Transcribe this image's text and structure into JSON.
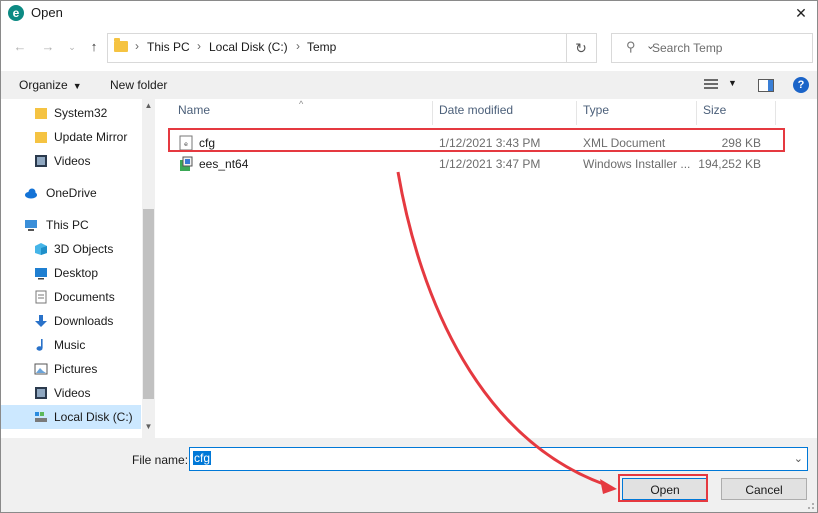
{
  "window": {
    "title": "Open",
    "app_icon": "eset-e-icon",
    "close_glyph": "✕"
  },
  "address": {
    "breadcrumb": [
      "This PC",
      "Local Disk (C:)",
      "Temp"
    ],
    "separator": "›"
  },
  "search": {
    "placeholder": "Search Temp"
  },
  "toolbar": {
    "organize_label": "Organize",
    "new_folder_label": "New folder",
    "help_glyph": "?"
  },
  "sidebar": {
    "items": [
      {
        "label": "System32",
        "icon": "folder-icon"
      },
      {
        "label": "Update Mirror",
        "icon": "folder-icon"
      },
      {
        "label": "Videos",
        "icon": "video-folder-icon"
      },
      {
        "label": "OneDrive",
        "icon": "cloud-icon"
      },
      {
        "label": "This PC",
        "icon": "computer-icon"
      },
      {
        "label": "3D Objects",
        "icon": "cube-icon"
      },
      {
        "label": "Desktop",
        "icon": "desktop-icon"
      },
      {
        "label": "Documents",
        "icon": "document-icon"
      },
      {
        "label": "Downloads",
        "icon": "download-icon"
      },
      {
        "label": "Music",
        "icon": "music-icon"
      },
      {
        "label": "Pictures",
        "icon": "pictures-icon"
      },
      {
        "label": "Videos",
        "icon": "video-folder-icon"
      },
      {
        "label": "Local Disk (C:)",
        "icon": "drive-icon",
        "selected": true
      }
    ]
  },
  "files": {
    "columns": [
      "Name",
      "Date modified",
      "Type",
      "Size"
    ],
    "rows": [
      {
        "name": "cfg",
        "date": "1/12/2021 3:43 PM",
        "type": "XML Document",
        "size": "298 KB",
        "icon": "xml-file-icon"
      },
      {
        "name": "ees_nt64",
        "date": "1/12/2021 3:47 PM",
        "type": "Windows Installer ...",
        "size": "194,252 KB",
        "icon": "installer-icon"
      }
    ]
  },
  "footer": {
    "file_name_label": "File name:",
    "file_name_value": "cfg",
    "open_label": "Open",
    "cancel_label": "Cancel"
  },
  "colors": {
    "accent": "#0078d7",
    "annotation": "#e53940",
    "selected_bg": "#cce8ff"
  }
}
